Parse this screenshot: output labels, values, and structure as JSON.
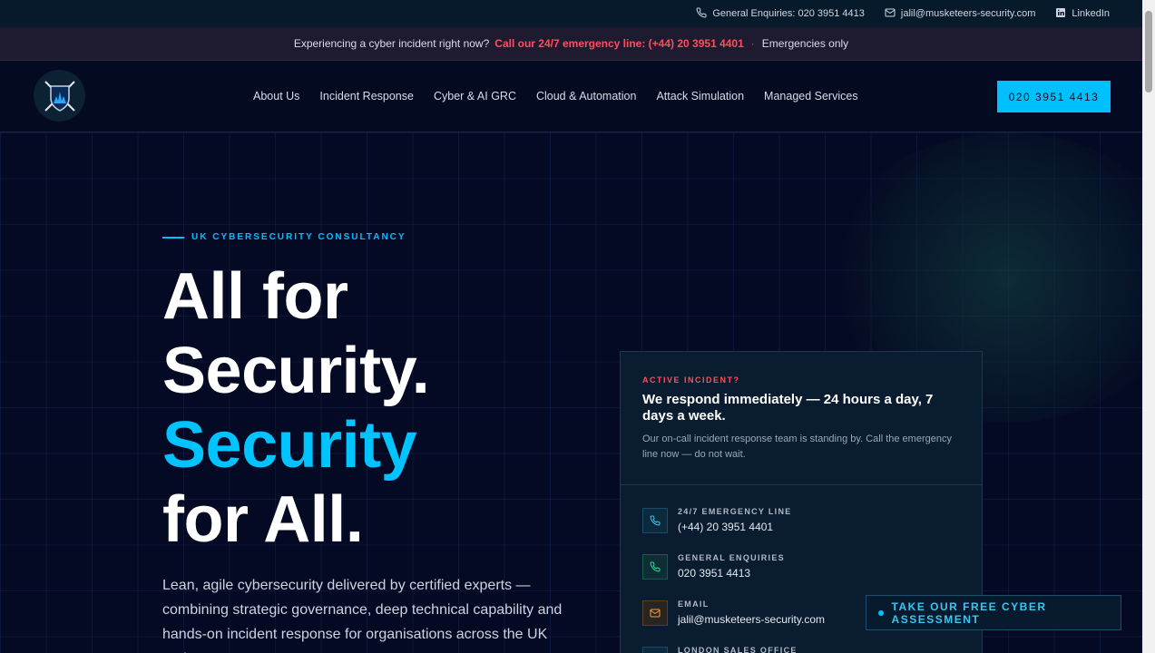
{
  "topbar": {
    "phone_label": "General Enquiries: 020 3951 4413",
    "email": "jalil@musketeers-security.com",
    "linkedin": "LinkedIn"
  },
  "alert": {
    "prefix": "Experiencing a cyber incident right now?",
    "emergency_link": "Call our 24/7 emergency line: (+44) 20 3951 4401",
    "suffix": "Emergencies only"
  },
  "nav": {
    "items": [
      "About Us",
      "Incident Response",
      "Cyber & AI GRC",
      "Cloud & Automation",
      "Attack Simulation",
      "Managed Services"
    ],
    "cta": "020 3951 4413"
  },
  "hero": {
    "eyebrow": "UK CYBERSECURITY CONSULTANCY",
    "headline": [
      "All for",
      "Security.",
      "Security",
      "for All."
    ],
    "lede": "Lean, agile cybersecurity delivered by certified experts — combining strategic governance, deep technical capability and hands-on incident response for organisations across the UK and"
  },
  "card": {
    "tag": "ACTIVE INCIDENT?",
    "title": "We respond immediately — 24 hours a day, 7 days a week.",
    "subtitle": "Our on-call incident response team is standing by. Call the emergency line now — do not wait.",
    "contacts": [
      {
        "label": "24/7 EMERGENCY LINE",
        "value": "(+44) 20 3951 4401",
        "icon": "phone-icon"
      },
      {
        "label": "GENERAL ENQUIRIES",
        "value": "020 3951 4413",
        "icon": "phone-icon"
      },
      {
        "label": "EMAIL",
        "value": "jalil@musketeers-security.com",
        "icon": "mail-icon"
      },
      {
        "label": "LONDON SALES OFFICE",
        "value": "",
        "icon": "location-icon"
      }
    ]
  },
  "floating_cta": "TAKE OUR FREE CYBER ASSESSMENT",
  "colors": {
    "accent": "#00bfff",
    "alert": "#ff4d5e",
    "background": "#050a24"
  }
}
